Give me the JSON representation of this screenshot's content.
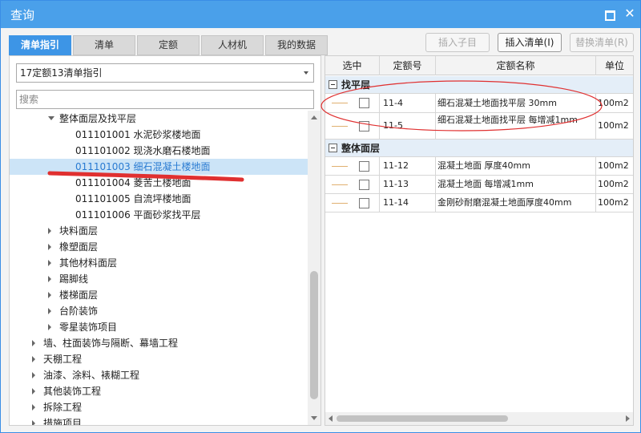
{
  "window": {
    "title": "查询"
  },
  "tabs": [
    "清单指引",
    "清单",
    "定额",
    "人材机",
    "我的数据"
  ],
  "toolbar": {
    "insert_sub": "插入子目",
    "insert_list": "插入清单(I)",
    "replace_list": "替换清单(R)"
  },
  "left": {
    "dropdown_value": "17定额13清单指引",
    "search_placeholder": "搜索",
    "tree": [
      {
        "label": "整体面层及找平层",
        "state": "expanded",
        "level": 2
      },
      {
        "label": "011101001  水泥砂浆楼地面",
        "state": "leaf",
        "level": 3
      },
      {
        "label": "011101002  现浇水磨石楼地面",
        "state": "leaf",
        "level": 3
      },
      {
        "label": "011101003  细石混凝土楼地面",
        "state": "leaf",
        "level": 3,
        "selected": true
      },
      {
        "label": "011101004  菱苦土楼地面",
        "state": "leaf",
        "level": 3
      },
      {
        "label": "011101005  自流坪楼地面",
        "state": "leaf",
        "level": 3
      },
      {
        "label": "011101006  平面砂浆找平层",
        "state": "leaf",
        "level": 3
      },
      {
        "label": "块料面层",
        "state": "collapsed",
        "level": 2
      },
      {
        "label": "橡塑面层",
        "state": "collapsed",
        "level": 2
      },
      {
        "label": "其他材料面层",
        "state": "collapsed",
        "level": 2
      },
      {
        "label": "踢脚线",
        "state": "collapsed",
        "level": 2
      },
      {
        "label": "楼梯面层",
        "state": "collapsed",
        "level": 2
      },
      {
        "label": "台阶装饰",
        "state": "collapsed",
        "level": 2
      },
      {
        "label": "零星装饰项目",
        "state": "collapsed",
        "level": 2
      },
      {
        "label": "墙、柱面装饰与隔断、幕墙工程",
        "state": "collapsed",
        "level": 1
      },
      {
        "label": "天棚工程",
        "state": "collapsed",
        "level": 1
      },
      {
        "label": "油漆、涂料、裱糊工程",
        "state": "collapsed",
        "level": 1
      },
      {
        "label": "其他装饰工程",
        "state": "collapsed",
        "level": 1
      },
      {
        "label": "拆除工程",
        "state": "collapsed",
        "level": 1
      },
      {
        "label": "措施项目",
        "state": "collapsed",
        "level": 1
      }
    ]
  },
  "table": {
    "headers": [
      "选中",
      "定额号",
      "定额名称",
      "单位"
    ],
    "groups": [
      {
        "name": "找平层",
        "rows": [
          {
            "code": "11-4",
            "name": "细石混凝土地面找平层 30mm",
            "unit": "100m2"
          },
          {
            "code": "11-5",
            "name": "细石混凝土地面找平层 每增减1mm",
            "unit": "100m2"
          }
        ]
      },
      {
        "name": "整体面层",
        "rows": [
          {
            "code": "11-12",
            "name": "混凝土地面 厚度40mm",
            "unit": "100m2"
          },
          {
            "code": "11-13",
            "name": "混凝土地面 每增减1mm",
            "unit": "100m2"
          },
          {
            "code": "11-14",
            "name": "金刚砂耐磨混凝土地面厚度40mm",
            "unit": "100m2"
          }
        ]
      }
    ]
  },
  "colors": {
    "accent": "#3d95e6",
    "annotation": "#e03030"
  }
}
